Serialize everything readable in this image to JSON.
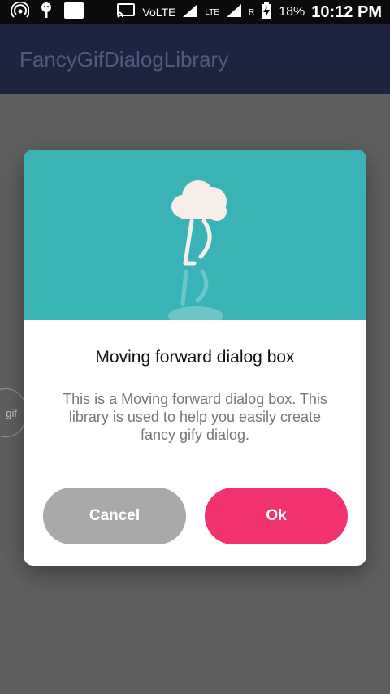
{
  "status_bar": {
    "volte": "VoLTE",
    "network_left": "LTE",
    "network_right": "R",
    "battery": "18%",
    "time": "10:12 PM"
  },
  "app_bar": {
    "title": "FancyGifDialogLibrary"
  },
  "side_handle": {
    "label": "gif"
  },
  "dialog": {
    "title": "Moving forward dialog box",
    "message": "This is a Moving forward dialog box. This library is used to help you easily create fancy gify dialog.",
    "cancel_label": "Cancel",
    "ok_label": "Ok"
  },
  "colors": {
    "media_bg": "#3ab3b6",
    "ok_button": "#f2316f",
    "cancel_button": "#a9a9a9",
    "app_bar": "#1c2440"
  }
}
